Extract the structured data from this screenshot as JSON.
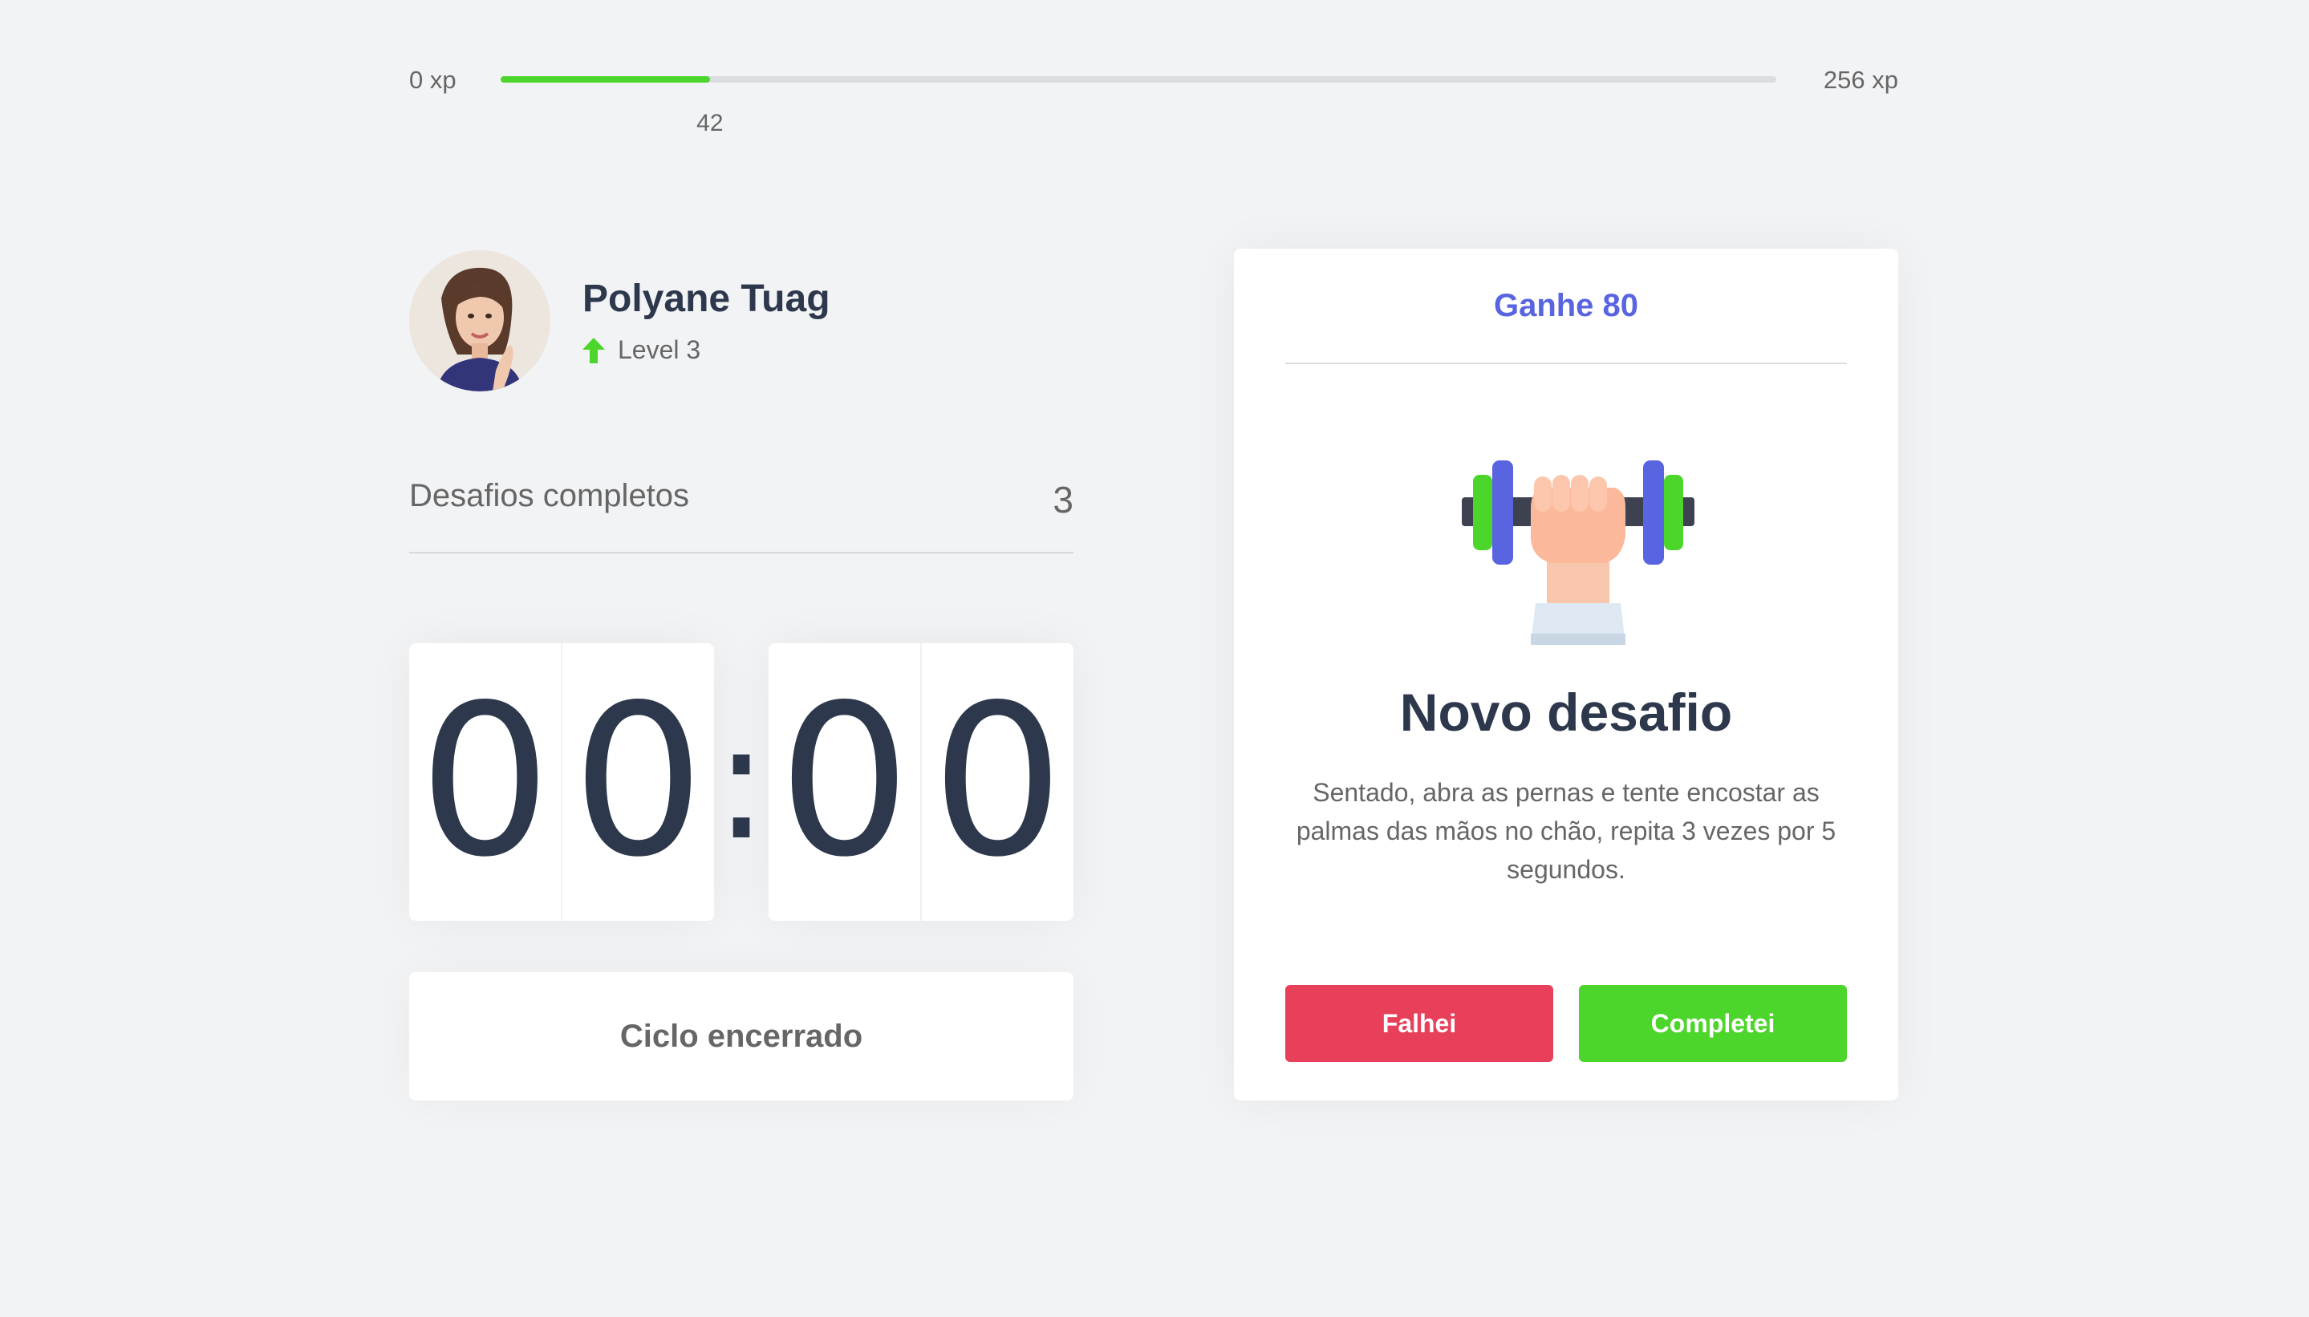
{
  "xp": {
    "min_label": "0 xp",
    "max_label": "256 xp",
    "current_label": "42",
    "current": 42,
    "max": 256,
    "bar_color": "#4cd62b"
  },
  "profile": {
    "name": "Polyane Tuag",
    "level_label": "Level 3",
    "level_icon": "level-up-arrow-icon"
  },
  "challenges": {
    "label": "Desafios completos",
    "count": "3"
  },
  "countdown": {
    "minute_left": "0",
    "minute_right": "0",
    "separator": ":",
    "second_left": "0",
    "second_right": "0"
  },
  "cycle_button": {
    "label": "Ciclo encerrado"
  },
  "challenge_card": {
    "header": "Ganhe 80",
    "icon": "dumbbell-icon",
    "title": "Novo desafio",
    "description": "Sentado, abra as pernas e tente encostar as palmas das mãos no chão, repita 3 vezes por 5 segundos.",
    "fail_label": "Falhei",
    "success_label": "Completei"
  },
  "colors": {
    "accent_blue": "#5965e0",
    "green": "#4cd62b",
    "red": "#e83f5b",
    "title": "#2e384d",
    "text": "#666666",
    "background": "#f2f3f5"
  }
}
